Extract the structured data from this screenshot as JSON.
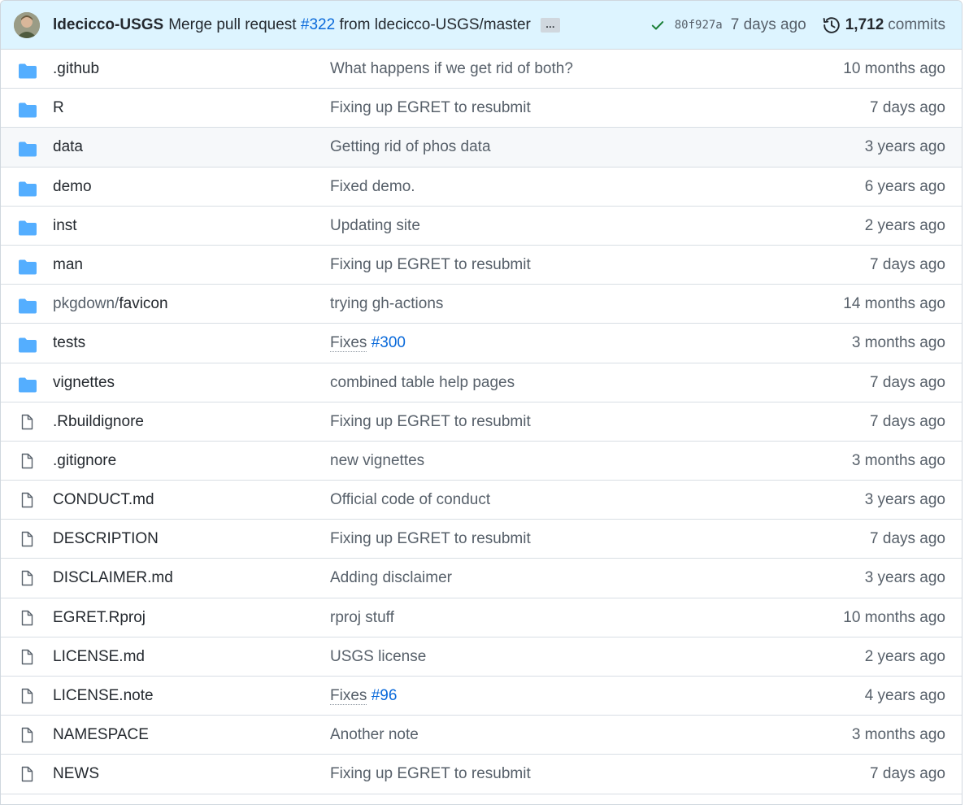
{
  "latest_commit": {
    "author": "ldecicco-USGS",
    "message_prefix": "Merge pull request",
    "pr_link": "#322",
    "message_suffix": "from ldecicco-USGS/master",
    "ellipsis": "…",
    "status_icon": "check-icon",
    "sha": "80f927a",
    "time": "7 days ago",
    "commits_count": "1,712",
    "commits_label": "commits"
  },
  "colors": {
    "header_bg": "#ddf4ff",
    "folder": "#54aeff",
    "file": "#57606a",
    "link": "#0969da",
    "check": "#1a7f37"
  },
  "files": [
    {
      "type": "folder",
      "name": ".github",
      "message": "What happens if we get rid of both?",
      "time": "10 months ago"
    },
    {
      "type": "folder",
      "name": "R",
      "message": "Fixing up EGRET to resubmit",
      "time": "7 days ago"
    },
    {
      "type": "folder",
      "name": "data",
      "message": "Getting rid of phos data",
      "time": "3 years ago"
    },
    {
      "type": "folder",
      "name": "demo",
      "message": "Fixed demo.",
      "time": "6 years ago"
    },
    {
      "type": "folder",
      "name": "inst",
      "message": "Updating site",
      "time": "2 years ago"
    },
    {
      "type": "folder",
      "name": "man",
      "message": "Fixing up EGRET to resubmit",
      "time": "7 days ago"
    },
    {
      "type": "folder",
      "name_prefix": "pkgdown/",
      "name": "favicon",
      "message": "trying gh-actions",
      "time": "14 months ago"
    },
    {
      "type": "folder",
      "name": "tests",
      "message": "Fixes",
      "message_link": "#300",
      "time": "3 months ago"
    },
    {
      "type": "folder",
      "name": "vignettes",
      "message": "combined table help pages",
      "time": "7 days ago"
    },
    {
      "type": "file",
      "name": ".Rbuildignore",
      "message": "Fixing up EGRET to resubmit",
      "time": "7 days ago"
    },
    {
      "type": "file",
      "name": ".gitignore",
      "message": "new vignettes",
      "time": "3 months ago"
    },
    {
      "type": "file",
      "name": "CONDUCT.md",
      "message": "Official code of conduct",
      "time": "3 years ago"
    },
    {
      "type": "file",
      "name": "DESCRIPTION",
      "message": "Fixing up EGRET to resubmit",
      "time": "7 days ago"
    },
    {
      "type": "file",
      "name": "DISCLAIMER.md",
      "message": "Adding disclaimer",
      "time": "3 years ago"
    },
    {
      "type": "file",
      "name": "EGRET.Rproj",
      "message": "rproj stuff",
      "time": "10 months ago"
    },
    {
      "type": "file",
      "name": "LICENSE.md",
      "message": "USGS license",
      "time": "2 years ago"
    },
    {
      "type": "file",
      "name": "LICENSE.note",
      "message": "Fixes",
      "message_link": "#96",
      "time": "4 years ago"
    },
    {
      "type": "file",
      "name": "NAMESPACE",
      "message": "Another note",
      "time": "3 months ago"
    },
    {
      "type": "file",
      "name": "NEWS",
      "message": "Fixing up EGRET to resubmit",
      "time": "7 days ago"
    }
  ]
}
